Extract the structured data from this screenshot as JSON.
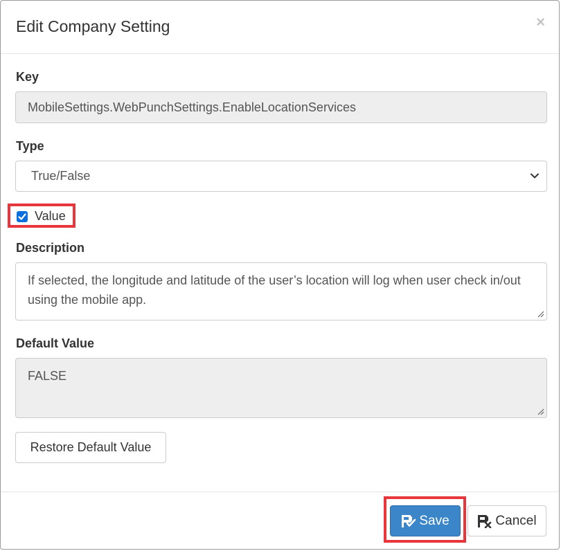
{
  "modal": {
    "title": "Edit Company Setting",
    "close_symbol": "×"
  },
  "form": {
    "key": {
      "label": "Key",
      "value": "MobileSettings.WebPunchSettings.EnableLocationServices"
    },
    "type": {
      "label": "Type",
      "selected": "True/False"
    },
    "value": {
      "label": "Value",
      "checked": true
    },
    "description": {
      "label": "Description",
      "value": "If selected, the longitude and latitude of the user’s location will log when user check in/out using the mobile app."
    },
    "default_value": {
      "label": "Default Value",
      "value": "FALSE"
    },
    "restore_label": "Restore Default Value"
  },
  "footer": {
    "save_label": "Save",
    "cancel_label": "Cancel"
  },
  "icons": {
    "close": "close-icon",
    "chevron": "chevron-down-icon",
    "checkbox": "check-icon",
    "save": "save-check-icon",
    "cancel": "save-cancel-icon"
  },
  "colors": {
    "primary": "#3a86c8",
    "highlight": "#e8363c",
    "checkbox": "#0b6fe0",
    "readonly_bg": "#eeeeee"
  }
}
